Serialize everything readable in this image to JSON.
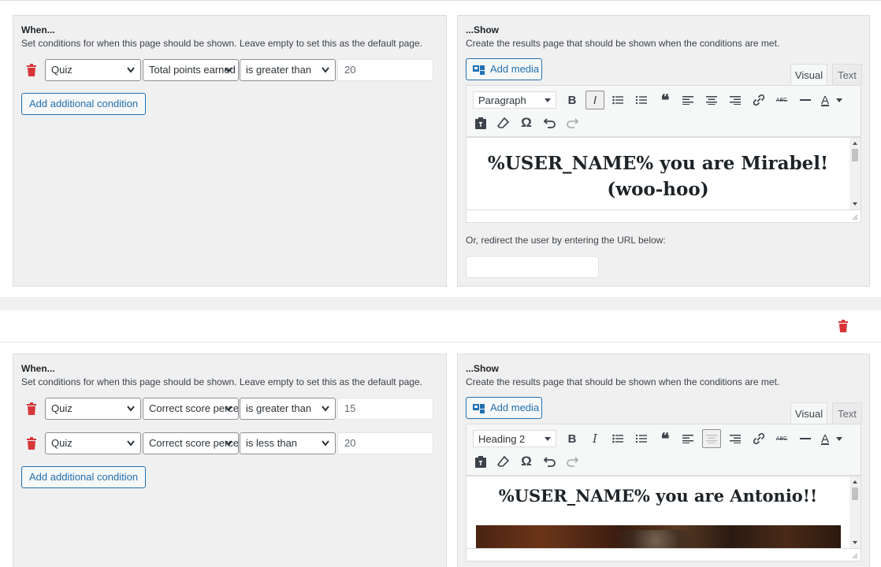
{
  "colors": {
    "danger": "#d63638",
    "primary": "#2271b1"
  },
  "icons": {
    "trash": "trash-icon",
    "chevron": "chevron-down-icon",
    "media": "add-media-icon",
    "bold": "bold-icon",
    "italic": "italic-icon",
    "bullet_list": "bullet-list-icon",
    "numbered_list": "numbered-list-icon",
    "blockquote": "blockquote-icon",
    "align_left": "align-left-icon",
    "align_center": "align-center-icon",
    "align_right": "align-right-icon",
    "link": "link-icon",
    "strikethrough": "strikethrough-icon",
    "hr": "horizontal-line-icon",
    "text_color": "text-color-icon",
    "paste_text": "paste-as-text-icon",
    "clear_formatting": "clear-formatting-icon",
    "special_char": "omega-icon",
    "undo": "undo-icon",
    "redo": "redo-icon"
  },
  "result1": {
    "when": {
      "title": "When...",
      "desc": "Set conditions for when this page should be shown. Leave empty to set this as the default page.",
      "conditions": [
        {
          "source": "Quiz",
          "metric": "Total points earned",
          "operator": "is greater than",
          "value": "20"
        }
      ],
      "add_label": "Add additional condition"
    },
    "show": {
      "title": "...Show",
      "desc": "Create the results page that should be shown when the conditions are met.",
      "media_label": "Add media",
      "tab_visual": "Visual",
      "tab_text": "Text",
      "format": "Paragraph",
      "text_color_glyph": "A",
      "strike_glyph": "ABC",
      "content": "%USER_NAME% you are Mirabel! (woo-hoo)",
      "redirect_label": "Or, redirect the user by entering the URL below:",
      "redirect_value": ""
    }
  },
  "result2": {
    "when": {
      "title": "When...",
      "desc": "Set conditions for when this page should be shown. Leave empty to set this as the default page.",
      "conditions": [
        {
          "source": "Quiz",
          "metric": "Correct score percentage",
          "operator": "is greater than",
          "value": "15"
        },
        {
          "source": "Quiz",
          "metric": "Correct score percentage",
          "operator": "is less than",
          "value": "20"
        }
      ],
      "add_label": "Add additional condition"
    },
    "show": {
      "title": "...Show",
      "desc": "Create the results page that should be shown when the conditions are met.",
      "media_label": "Add media",
      "tab_visual": "Visual",
      "tab_text": "Text",
      "format": "Heading 2",
      "text_color_glyph": "A",
      "strike_glyph": "ABC",
      "content": "%USER_NAME% you are Antonio!!"
    }
  }
}
